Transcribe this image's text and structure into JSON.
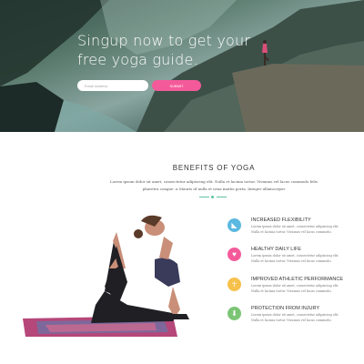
{
  "hero": {
    "title": "Singup now to get your free yoga guide.",
    "email_placeholder": "Email address",
    "submit_label": "SUBMIT"
  },
  "benefits": {
    "heading": "BENEFITS OF YOGA",
    "intro": "Lorem ipsum dolor sit amet, consectetur adipiscing elit. Nulla et lacinia tortor. Vivamus vel lacus commodo felis pharetra congue. n Mauris id nulla et urna mattis porta. Integer ullamcorper",
    "items": [
      {
        "title": "INCREASED FLEXIBILITY",
        "text": "Lorem ipsum dolor sit amet, consectetur adipiscing elit. Nulla et lacinia tortor. Vivamus vel lacus commodo.",
        "icon": "flexibility-icon",
        "color": "#5bb8e0"
      },
      {
        "title": "HEALTHY DAILY LIFE",
        "text": "Lorem ipsum dolor sit amet, consectetur adipiscing elit. Nulla et lacinia tortor. Vivamus vel lacus commodo.",
        "icon": "heart-icon",
        "color": "#f45a9a"
      },
      {
        "title": "IMPROVED ATHLETIC PERFORMANCE",
        "text": "Lorem ipsum dolor sit amet, consectetur adipiscing elit. Nulla et lacinia tortor. Vivamus vel lacus commodo.",
        "icon": "meditation-icon",
        "color": "#f6c14b"
      },
      {
        "title": "PROTECTION FROM INJURY",
        "text": "Lorem ipsum dolor sit amet, consectetur adipiscing elit. Nulla et lacinia tortor. Vivamus vel lacus commodo.",
        "icon": "down-arrow-icon",
        "color": "#7cc576"
      }
    ]
  },
  "colors": {
    "accent_pink": "#f45a9a",
    "divider": "#5fc0a5"
  }
}
